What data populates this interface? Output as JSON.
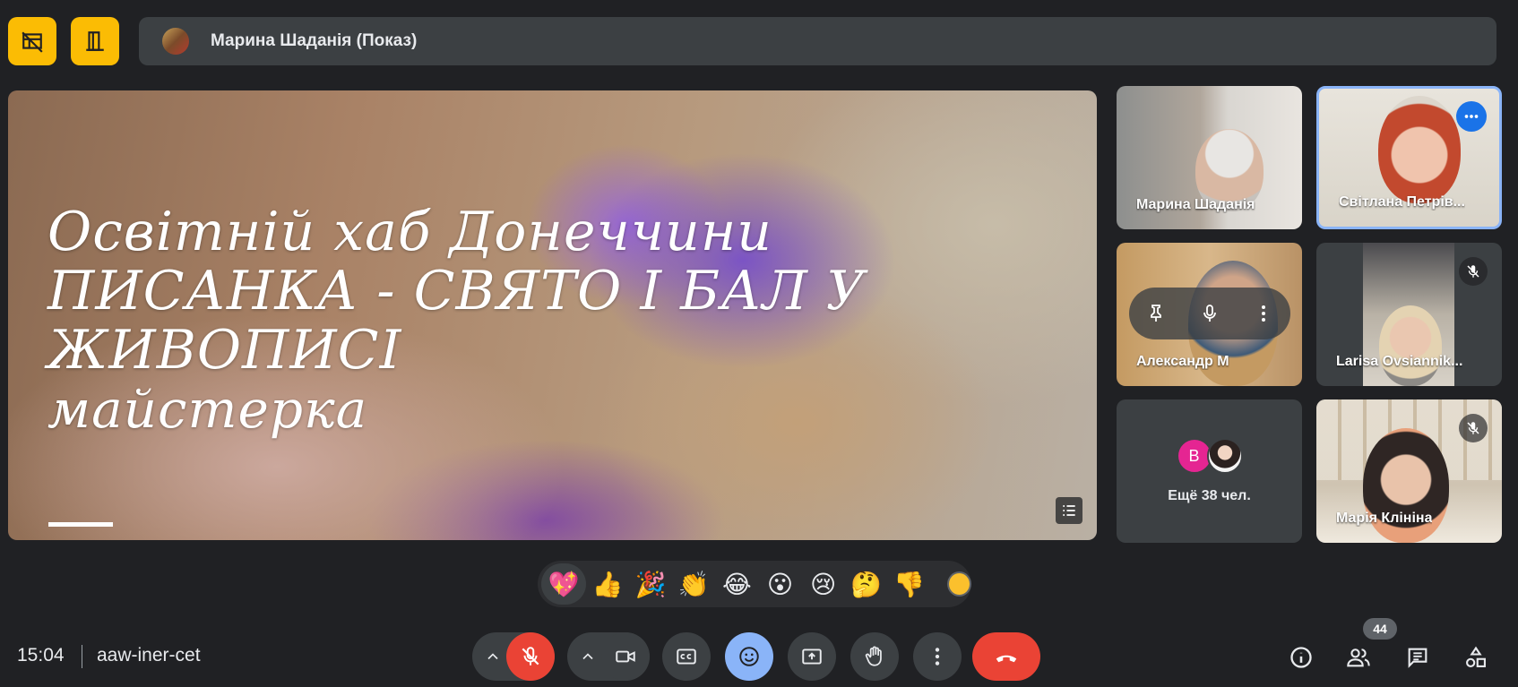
{
  "top_bar": {
    "presentation_label": "Марина Шаданія (Показ)"
  },
  "slide": {
    "lines": [
      "Освітній  хаб  Донеччини",
      "ПИСАНКА  -  СВЯТО  І  БАЛ  У",
      "ЖИВОПИСІ",
      "майстерка"
    ]
  },
  "participants": [
    {
      "name": "Марина Шаданія",
      "muted": false
    },
    {
      "name": "Світлана Петрів...",
      "muted": false,
      "pinned_menu": true
    },
    {
      "name": "Александр М",
      "muted": false
    },
    {
      "name": "Larisa Ovsiannik...",
      "muted": true
    },
    {
      "name": "Марія Клініна",
      "muted": true
    }
  ],
  "others_tile": {
    "avatar_letter": "B",
    "label": "Ещё 38 чел."
  },
  "reactions": [
    "💖",
    "👍",
    "🎉",
    "👏",
    "😂",
    "😮",
    "😢",
    "🤔",
    "👎"
  ],
  "footer": {
    "time": "15:04",
    "meeting_code": "aaw-iner-cet",
    "participant_count": "44"
  },
  "colors": {
    "accent_yellow": "#fbbc04",
    "end_call_red": "#ea4335",
    "active_blue": "#8ab4f8",
    "background": "#202124"
  }
}
